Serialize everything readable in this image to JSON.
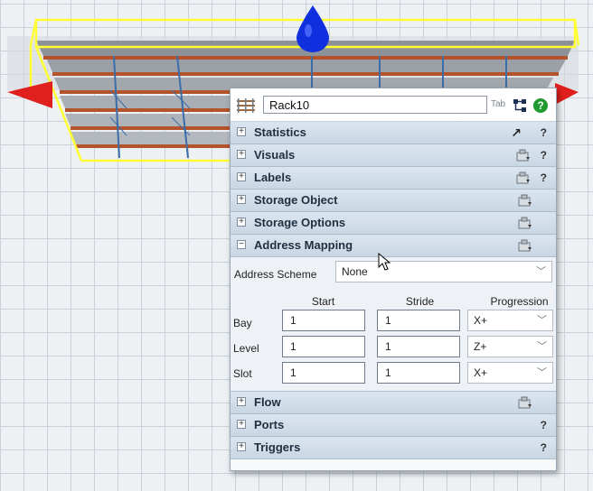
{
  "object_name": "Rack10",
  "header": {
    "tab_hint": "Tab"
  },
  "sections_top": [
    {
      "label": "Statistics",
      "expander": "+",
      "help": "?"
    },
    {
      "label": "Visuals",
      "expander": "+",
      "help": "?"
    },
    {
      "label": "Labels",
      "expander": "+",
      "help": "?"
    },
    {
      "label": "Storage Object",
      "expander": "+"
    },
    {
      "label": "Storage Options",
      "expander": "+"
    },
    {
      "label": "Address Mapping",
      "expander": "−"
    }
  ],
  "address_mapping": {
    "scheme_label": "Address Scheme",
    "scheme_value": "None",
    "columns": [
      "Start",
      "Stride",
      "Progression"
    ],
    "rows": [
      {
        "label": "Bay",
        "start": "1",
        "stride": "1",
        "progression": "X+"
      },
      {
        "label": "Level",
        "start": "1",
        "stride": "1",
        "progression": "Z+"
      },
      {
        "label": "Slot",
        "start": "1",
        "stride": "1",
        "progression": "X+"
      }
    ]
  },
  "sections_bottom": [
    {
      "label": "Flow",
      "expander": "+"
    },
    {
      "label": "Ports",
      "expander": "+",
      "help": "?"
    },
    {
      "label": "Triggers",
      "expander": "+",
      "help": "?"
    }
  ],
  "colors": {
    "selection": "#ffff33",
    "shelf": "#b5532c",
    "post": "#3a6ea8",
    "arrow_red": "#e0201c",
    "arrow_blue": "#1030e0",
    "help_green": "#1f9a2e"
  }
}
